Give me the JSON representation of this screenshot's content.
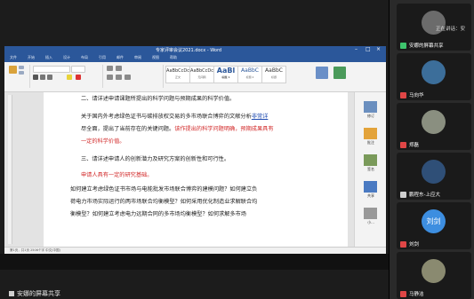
{
  "word": {
    "title": "专家评审会议2021.docx - Word",
    "tabs": [
      "文件",
      "开始",
      "插入",
      "设计",
      "布局",
      "引用",
      "邮件",
      "审阅",
      "视图",
      "帮助"
    ],
    "styles": [
      {
        "sample": "AaBbCcDc",
        "name": "正文"
      },
      {
        "sample": "AaBbCcDc",
        "name": "无间隔"
      },
      {
        "sample": "AaBl",
        "name": "标题 1"
      },
      {
        "sample": "AaBbC",
        "name": "标题 2"
      },
      {
        "sample": "AaBbC",
        "name": "标题"
      }
    ],
    "doc": {
      "heading2": "二、请详述申请课题所提出的科学问题与预期成果的科学价值。",
      "p1_a": "关于国内外考虑绿色证书与碳排放权交易的多市场联合博弈的文献分析",
      "p1_link": "非常详",
      "p2_a": "尽全面，提出了当前存在的关键问题。",
      "p2_red": "该作提出的科学问题明确，预期成果具有",
      "p3_red": "一定的科学价值。",
      "heading3": "三、请详述申请人的创新潜力及研究方案的创新性和可行性。",
      "p4_red": "申请人具有一定的研究基础。",
      "p5": "如何建立考虑绿色证书市场与电能批发市场联合博弈的建模问题？如何建立负",
      "p6": "荷电力市场实际运行的两市场联合均衡模型？如何采用优化制造业求解联合均",
      "p7": "衡模型？如何建立考虑电力远期合同的多市场均衡模型？如何求解多市场"
    },
    "status": "第1页，共1页  2506个字  中文(中国)",
    "right_panel": [
      "修订",
      "批注",
      "签名",
      "共享",
      "小..."
    ]
  },
  "share_label": "安娜的屏幕共享",
  "sidebar": {
    "speaking": "正在讲话：安",
    "tiles": [
      {
        "name": "安娜的屏幕共享",
        "avatar": "#6b6b6b"
      },
      {
        "name": "马向华",
        "avatar": "#3c6e9a"
      },
      {
        "name": "郑磊",
        "avatar": "#8a8f80"
      },
      {
        "name": "鹏程东-上应大",
        "avatar": "#2f4f77"
      },
      {
        "name": "刘剑",
        "avatar": "#3d8ee0",
        "text": "刘剑"
      },
      {
        "name": "马静洁",
        "avatar": "#8a8a70"
      }
    ]
  }
}
